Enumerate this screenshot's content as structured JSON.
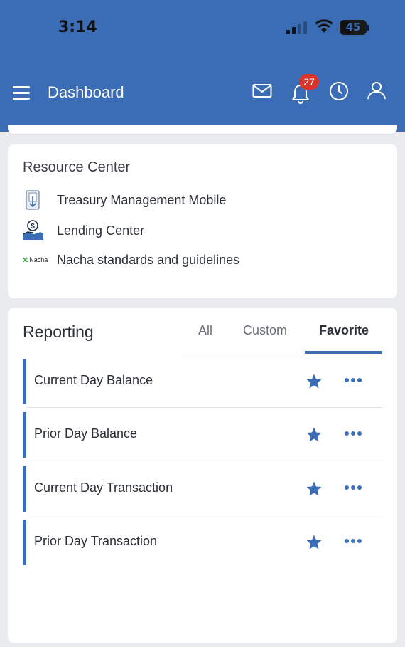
{
  "status_bar": {
    "time": "3:14",
    "battery": "45",
    "battery_fraction": 0.45
  },
  "header": {
    "title": "Dashboard",
    "notification_count": "27",
    "icons": [
      "menu-icon",
      "mail-icon",
      "bell-icon",
      "clock-icon",
      "user-icon"
    ]
  },
  "resource_center": {
    "title": "Resource Center",
    "items": [
      {
        "label": "Treasury Management Mobile",
        "icon": "mobile-document-icon"
      },
      {
        "label": "Lending Center",
        "icon": "hand-dollar-icon"
      },
      {
        "label": "Nacha standards and guidelines",
        "icon": "nacha-logo",
        "logo_text": "Nacha"
      }
    ]
  },
  "reporting": {
    "title": "Reporting",
    "tabs": [
      {
        "label": "All",
        "active": false
      },
      {
        "label": "Custom",
        "active": false
      },
      {
        "label": "Favorite",
        "active": true
      }
    ],
    "rows": [
      {
        "label": "Current Day Balance",
        "favorite": true
      },
      {
        "label": "Prior Day Balance",
        "favorite": true
      },
      {
        "label": "Current Day Transaction",
        "favorite": true
      },
      {
        "label": "Prior Day Transaction",
        "favorite": true
      }
    ]
  },
  "colors": {
    "brand": "#3a6db5",
    "badge": "#d9352b",
    "text": "#2b2f36"
  }
}
